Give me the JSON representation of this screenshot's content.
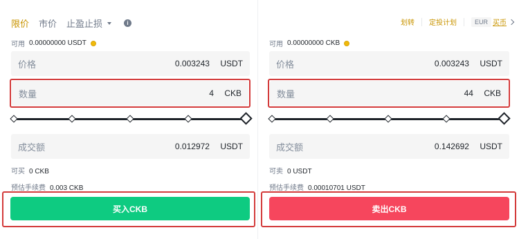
{
  "tabs": {
    "limit": "限价",
    "market": "市价",
    "stop": "止盈止损"
  },
  "top_links": {
    "transfer": "划转",
    "auto_invest": "定投计划",
    "currency": "EUR",
    "buy_coin": "买币"
  },
  "buy": {
    "available_label": "可用",
    "available_value": "0.00000000 USDT",
    "price_label": "价格",
    "price_value": "0.003243",
    "price_unit": "USDT",
    "amount_label": "数量",
    "amount_value": "4",
    "amount_unit": "CKB",
    "total_label": "成交额",
    "total_value": "0.012972",
    "total_unit": "USDT",
    "max_label": "可买",
    "max_value": "0 CKB",
    "fee_label": "预估手续费",
    "fee_value": "0.003 CKB",
    "button": "买入CKB",
    "slider_percent": 100
  },
  "sell": {
    "available_label": "可用",
    "available_value": "0.00000000 CKB",
    "price_label": "价格",
    "price_value": "0.003243",
    "price_unit": "USDT",
    "amount_label": "数量",
    "amount_value": "44",
    "amount_unit": "CKB",
    "total_label": "成交额",
    "total_value": "0.142692",
    "total_unit": "USDT",
    "max_label": "可卖",
    "max_value": "0 USDT",
    "fee_label": "预估手续费",
    "fee_value": "0.00010701 USDT",
    "button": "卖出CKB",
    "slider_percent": 100
  },
  "colors": {
    "accent": "#c99400",
    "buy": "#0ecb81",
    "sell": "#f6465d",
    "highlight": "#d33a3a"
  }
}
